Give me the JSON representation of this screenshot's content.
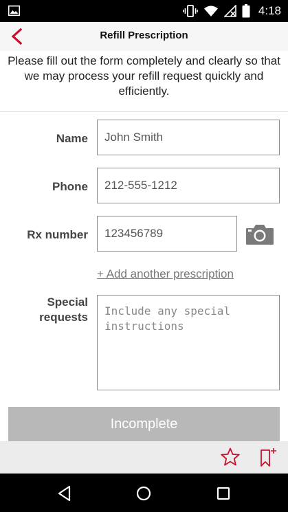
{
  "status_bar": {
    "time": "4:18",
    "icons": [
      "gallery-icon",
      "vibrate-icon",
      "wifi-icon",
      "no-signal-icon",
      "battery-icon"
    ]
  },
  "app_bar": {
    "title": "Refill Prescription",
    "back_icon": "chevron-left-icon",
    "accent_color": "#c8102e"
  },
  "intro_text": "Please fill out the form completely and clearly so that we may process your refill request quickly and efficiently.",
  "form": {
    "name_label": "Name",
    "name_value": "John Smith",
    "phone_label": "Phone",
    "phone_value": "212-555-1212",
    "rx_label": "Rx number",
    "rx_value": "123456789",
    "camera_icon": "camera-icon",
    "add_prescription": "+ Add another prescription",
    "special_label_line1": "Special",
    "special_label_line2": "requests",
    "special_placeholder": "Include any special instructions"
  },
  "submit_label": "Incomplete",
  "bottom_actions": {
    "star_icon": "star-icon",
    "bookmark_icon": "bookmark-add-icon"
  },
  "nav_bar": {
    "back": "nav-back-icon",
    "home": "nav-home-icon",
    "recents": "nav-recents-icon"
  }
}
